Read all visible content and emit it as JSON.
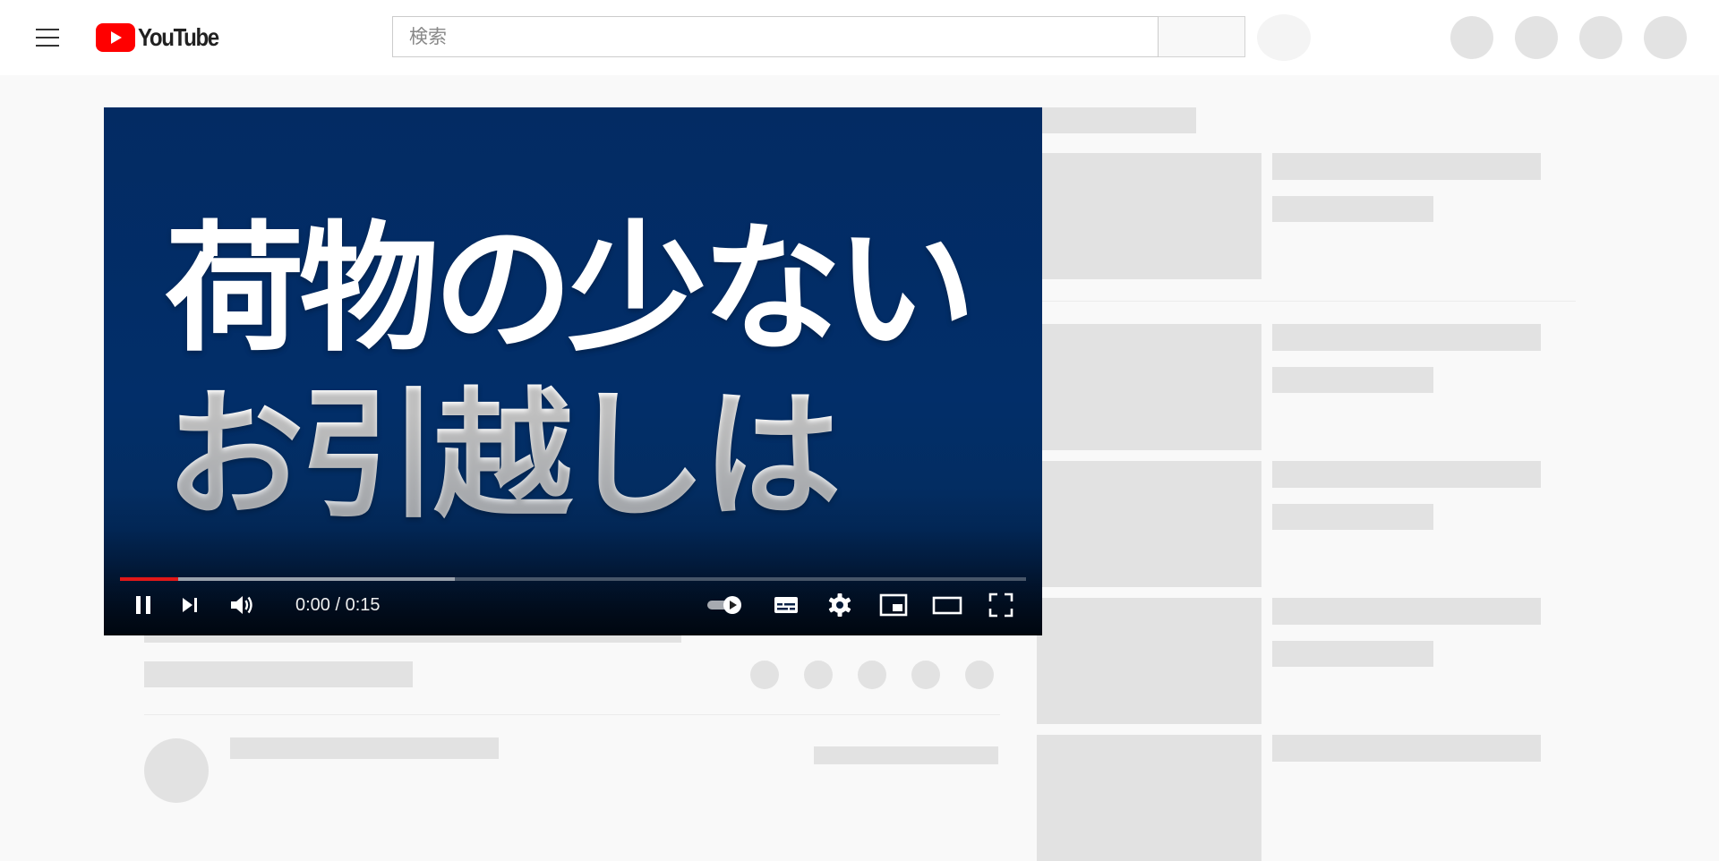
{
  "masthead": {
    "logo_text": "YouTube",
    "search_placeholder": "検索",
    "search_value": "",
    "brand_red": "#ff0000"
  },
  "player": {
    "overlay_line1": "荷物の少ない",
    "overlay_line2": "お引越しは",
    "time_current": "0:00",
    "time_separator": " / ",
    "time_duration": "0:15",
    "progress_played_fraction": 0.064,
    "progress_buffered_fraction": 0.37,
    "autoplay_on": true,
    "accent": "#e31818",
    "background_color": "#032b63",
    "icons": [
      "pause-icon",
      "next-icon",
      "volume-icon",
      "autoplay-toggle-icon",
      "subtitles-icon",
      "settings-icon",
      "miniplayer-icon",
      "theater-mode-icon",
      "fullscreen-icon"
    ]
  }
}
